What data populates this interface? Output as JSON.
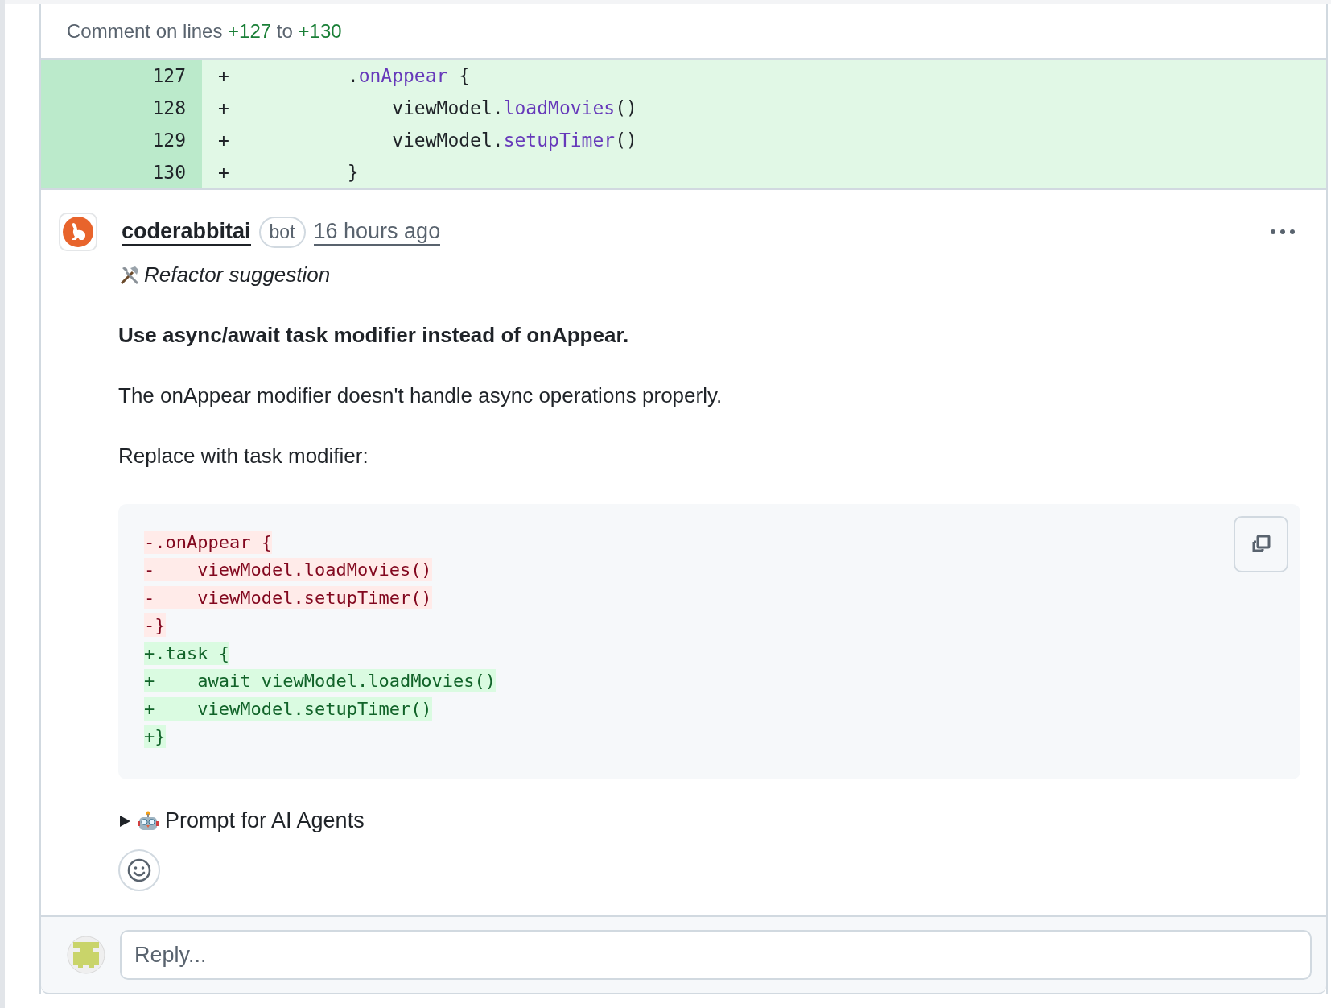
{
  "context": {
    "label": "Comment on lines",
    "from": "+127",
    "joiner": "to",
    "to": "+130"
  },
  "diff_lines": [
    {
      "number": "127",
      "sign": "+",
      "tokens": [
        {
          "text": "        .",
          "kind": "plain"
        },
        {
          "text": "onAppear",
          "kind": "fn"
        },
        {
          "text": " {",
          "kind": "plain"
        }
      ]
    },
    {
      "number": "128",
      "sign": "+",
      "tokens": [
        {
          "text": "            viewModel.",
          "kind": "plain"
        },
        {
          "text": "loadMovies",
          "kind": "fn"
        },
        {
          "text": "()",
          "kind": "plain"
        }
      ]
    },
    {
      "number": "129",
      "sign": "+",
      "tokens": [
        {
          "text": "            viewModel.",
          "kind": "plain"
        },
        {
          "text": "setupTimer",
          "kind": "fn"
        },
        {
          "text": "()",
          "kind": "plain"
        }
      ]
    },
    {
      "number": "130",
      "sign": "+",
      "tokens": [
        {
          "text": "        }",
          "kind": "plain"
        }
      ]
    }
  ],
  "comment": {
    "author": "coderabbitai",
    "badge": "bot",
    "time": "16 hours ago",
    "tag": "Refactor suggestion",
    "title": "Use async/await task modifier instead of onAppear.",
    "paragraphs": [
      "The onAppear modifier doesn't handle async operations properly.",
      "Replace with task modifier:"
    ],
    "suggestion": [
      {
        "kind": "del",
        "text": "-.onAppear {"
      },
      {
        "kind": "del",
        "text": "-    viewModel.loadMovies()"
      },
      {
        "kind": "del",
        "text": "-    viewModel.setupTimer()"
      },
      {
        "kind": "del",
        "text": "-}"
      },
      {
        "kind": "add",
        "text": "+.task {"
      },
      {
        "kind": "add",
        "text": "+    await viewModel.loadMovies()"
      },
      {
        "kind": "add",
        "text": "+    viewModel.setupTimer()"
      },
      {
        "kind": "add",
        "text": "+}"
      }
    ],
    "details": {
      "label": "Prompt for AI Agents",
      "expanded": false
    }
  },
  "reply": {
    "placeholder": "Reply..."
  }
}
